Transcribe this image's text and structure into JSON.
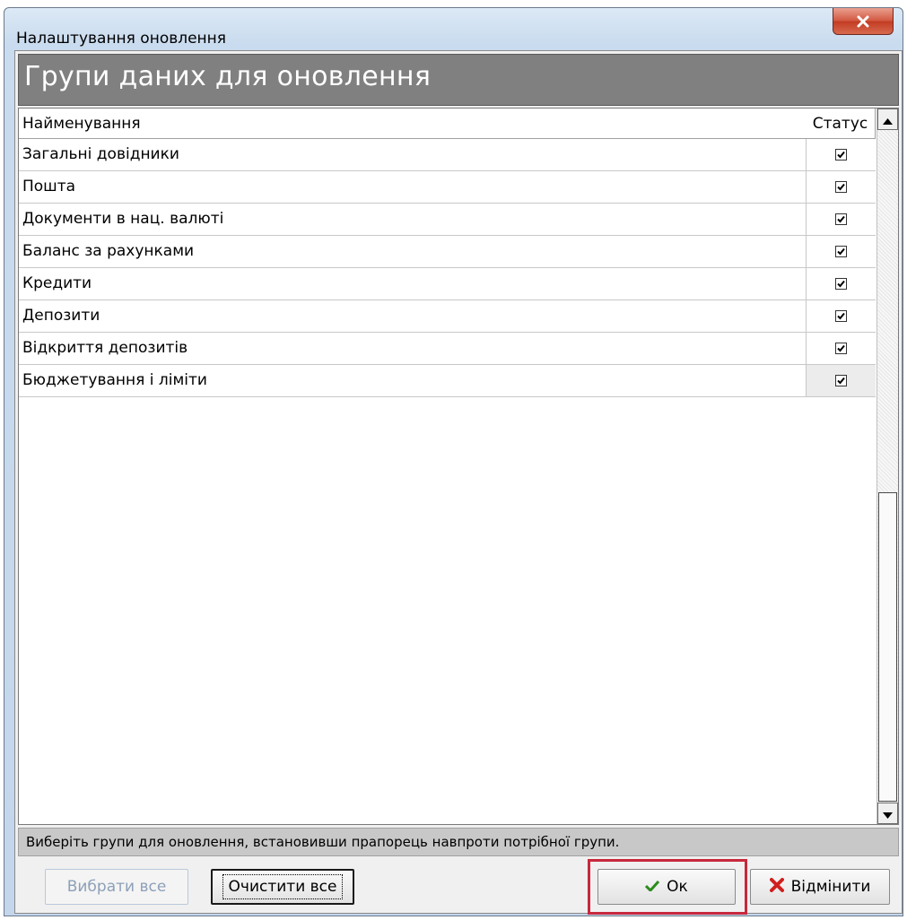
{
  "window": {
    "title": "Налаштування оновлення"
  },
  "header": {
    "title": "Групи даних для оновлення"
  },
  "grid": {
    "columns": [
      "Найменування",
      "Статус"
    ],
    "rows": [
      {
        "name": "Загальні довідники",
        "checked": true
      },
      {
        "name": "Пошта",
        "checked": true
      },
      {
        "name": "Документи в нац. валюті",
        "checked": true
      },
      {
        "name": "Баланс за рахунками",
        "checked": true
      },
      {
        "name": "Кредити",
        "checked": true
      },
      {
        "name": "Депозити",
        "checked": true
      },
      {
        "name": "Відкриття депозитів",
        "checked": true
      },
      {
        "name": "Бюджетування і ліміти",
        "checked": true
      }
    ]
  },
  "hint": "Виберіть групи для оновлення, встановивши прапорець навпроти потрібної групи.",
  "buttons": {
    "select_all": "Вибрати все",
    "clear_all": "Очистити все",
    "ok": "Ок",
    "cancel": "Відмінити"
  },
  "colors": {
    "header_band": "#808080",
    "ok_highlight": "#c8283c",
    "ok_icon": "#2e8b1e",
    "cancel_icon": "#d0201e",
    "close_button": "#c23b22"
  }
}
